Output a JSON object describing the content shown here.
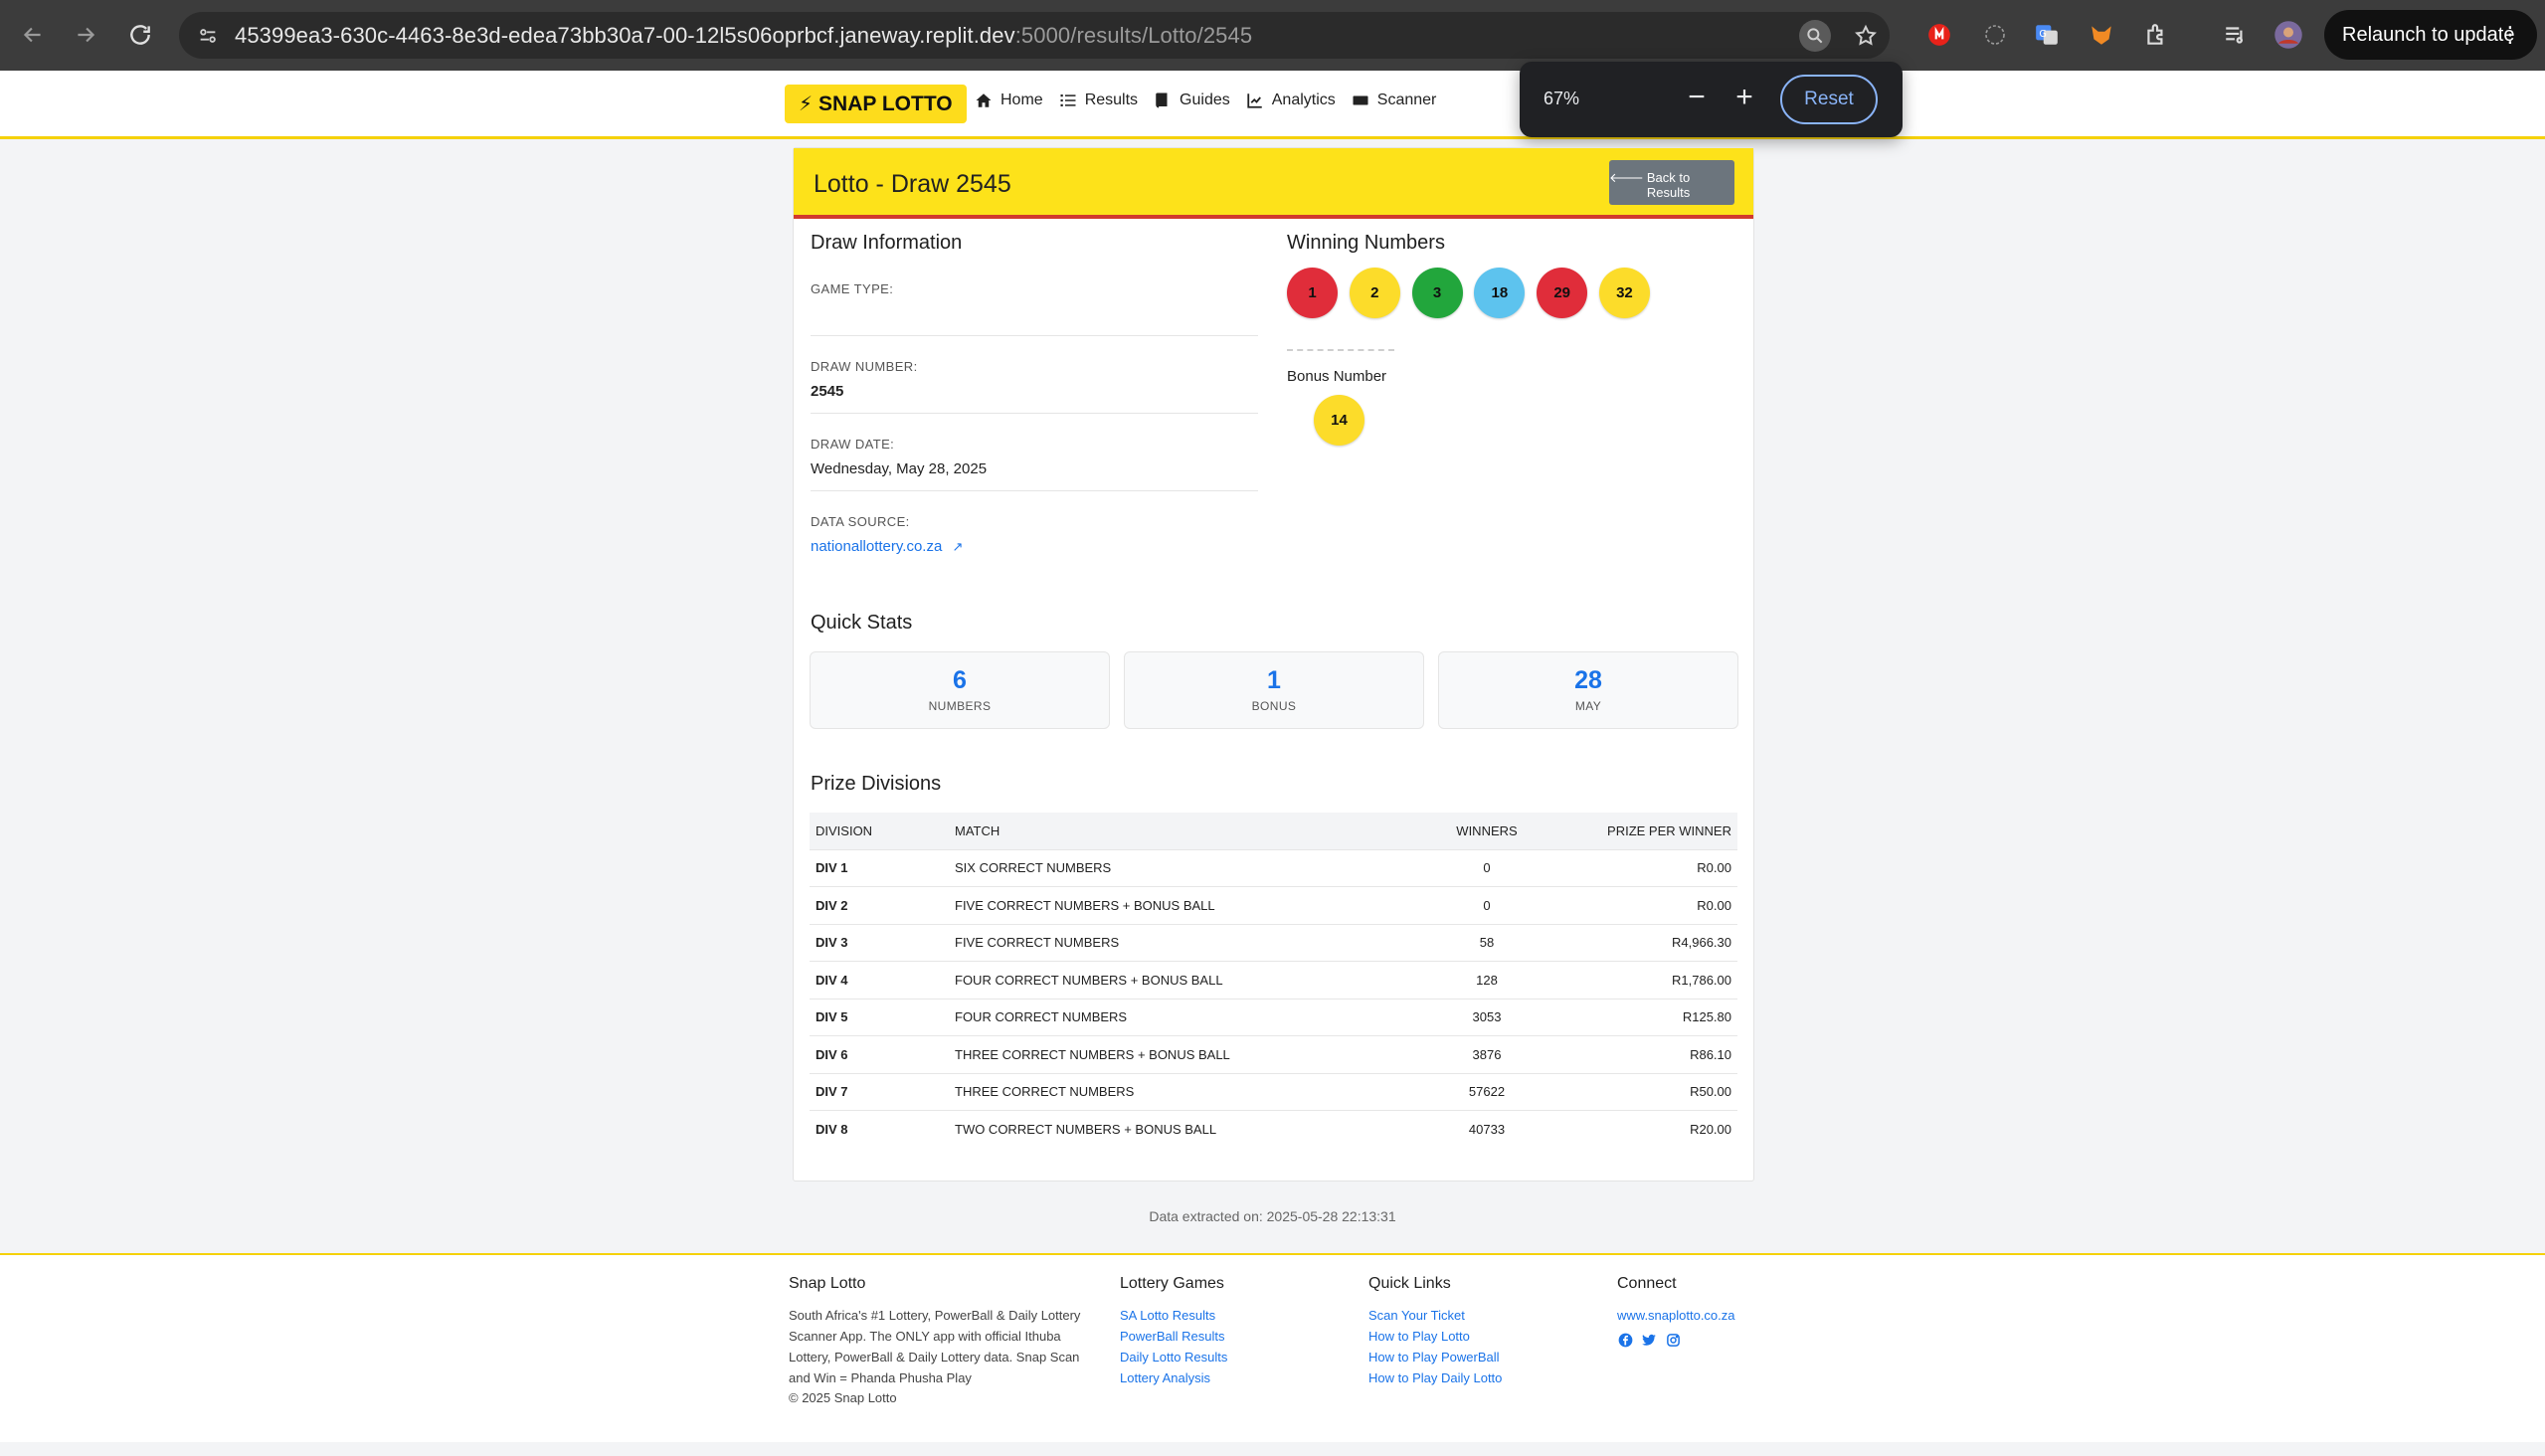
{
  "browser": {
    "url_host": "45399ea3-630c-4463-8e3d-edea73bb30a7-00-12l5s06oprbcf.janeway.replit.dev",
    "url_path": ":5000/results/Lotto/2545",
    "relaunch_label": "Relaunch to update",
    "zoom": {
      "level": "67%",
      "reset_label": "Reset"
    }
  },
  "site": {
    "brand": "SNAP LOTTO",
    "nav": [
      "Home",
      "Results",
      "Guides",
      "Analytics",
      "Scanner"
    ]
  },
  "draw": {
    "title": "Lotto - Draw 2545",
    "back_label": "Back to Results",
    "info_title": "Draw Information",
    "game_type_label": "GAME TYPE:",
    "game_type_value": "",
    "draw_number_label": "DRAW NUMBER:",
    "draw_number_value": "2545",
    "draw_date_label": "DRAW DATE:",
    "draw_date_value": "Wednesday, May 28, 2025",
    "data_source_label": "DATA SOURCE:",
    "data_source_value": "nationallottery.co.za",
    "winning_title": "Winning Numbers",
    "winning_numbers": [
      {
        "n": "1",
        "color": "#e02d3a"
      },
      {
        "n": "2",
        "color": "#fcdc2a"
      },
      {
        "n": "3",
        "color": "#22a63c"
      },
      {
        "n": "18",
        "color": "#5dc3ee"
      },
      {
        "n": "29",
        "color": "#e02d3a"
      },
      {
        "n": "32",
        "color": "#fcdc2a"
      }
    ],
    "bonus_label": "Bonus Number",
    "bonus_number": {
      "n": "14",
      "color": "#fcdc2a"
    }
  },
  "quick_stats": {
    "title": "Quick Stats",
    "items": [
      {
        "value": "6",
        "label": "NUMBERS"
      },
      {
        "value": "1",
        "label": "BONUS"
      },
      {
        "value": "28",
        "label": "MAY"
      }
    ]
  },
  "prizes": {
    "title": "Prize Divisions",
    "headers": [
      "DIVISION",
      "MATCH",
      "WINNERS",
      "PRIZE PER WINNER"
    ],
    "rows": [
      [
        "DIV 1",
        "SIX CORRECT NUMBERS",
        "0",
        "R0.00"
      ],
      [
        "DIV 2",
        "FIVE CORRECT NUMBERS + BONUS BALL",
        "0",
        "R0.00"
      ],
      [
        "DIV 3",
        "FIVE CORRECT NUMBERS",
        "58",
        "R4,966.30"
      ],
      [
        "DIV 4",
        "FOUR CORRECT NUMBERS + BONUS BALL",
        "128",
        "R1,786.00"
      ],
      [
        "DIV 5",
        "FOUR CORRECT NUMBERS",
        "3053",
        "R125.80"
      ],
      [
        "DIV 6",
        "THREE CORRECT NUMBERS + BONUS BALL",
        "3876",
        "R86.10"
      ],
      [
        "DIV 7",
        "THREE CORRECT NUMBERS",
        "57622",
        "R50.00"
      ],
      [
        "DIV 8",
        "TWO CORRECT NUMBERS + BONUS BALL",
        "40733",
        "R20.00"
      ]
    ]
  },
  "extracted": "Data extracted on: 2025-05-28 22:13:31",
  "footer": {
    "about_title": "Snap Lotto",
    "about_text": "South Africa's #1 Lottery, PowerBall & Daily Lottery Scanner App. The ONLY app with official Ithuba Lottery, PowerBall & Daily Lottery data. Snap Scan and Win = Phanda Phusha Play",
    "copyright": "© 2025 Snap Lotto",
    "games_title": "Lottery Games",
    "games": [
      "SA Lotto Results",
      "PowerBall Results",
      "Daily Lotto Results",
      "Lottery Analysis"
    ],
    "quick_title": "Quick Links",
    "quick": [
      "Scan Your Ticket",
      "How to Play Lotto",
      "How to Play PowerBall",
      "How to Play Daily Lotto"
    ],
    "connect_title": "Connect",
    "connect_link": "www.snaplotto.co.za",
    "social_icons": [
      "facebook-icon",
      "twitter-icon",
      "instagram-icon"
    ]
  }
}
